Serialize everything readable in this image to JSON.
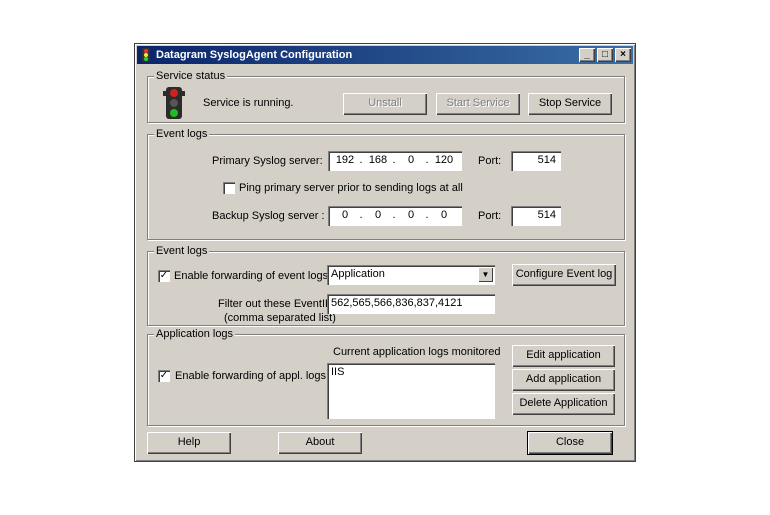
{
  "window": {
    "title": "Datagram SyslogAgent Configuration",
    "controls": {
      "minimize": "_",
      "maximize": "□",
      "close": "×"
    }
  },
  "service_status": {
    "group_label": "Service status",
    "icon": "traffic-light-icon",
    "status_text": "Service is running.",
    "uninstall_label": "Unstall",
    "start_label": "Start Service",
    "stop_label": "Stop Service"
  },
  "event_logs_servers": {
    "group_label": "Event logs",
    "primary_label": "Primary Syslog server:",
    "primary_ip": [
      "192",
      "168",
      "0",
      "120"
    ],
    "primary_port_label": "Port:",
    "primary_port": "514",
    "ping_label": "Ping primary server prior to sending logs at all",
    "ping_checked": "",
    "backup_label": "Backup Syslog server :",
    "backup_ip": [
      "0",
      "0",
      "0",
      "0"
    ],
    "backup_port_label": "Port:",
    "backup_port": "514",
    "ip_separator": "."
  },
  "event_logs_forwarding": {
    "group_label": "Event logs",
    "enable_label": "Enable forwarding of event logs",
    "enable_checked": "✓",
    "log_select_value": "Application",
    "configure_label": "Configure Event log",
    "filter_label": "Filter out these EventIDs:",
    "filter_sublabel": "(comma separated list)",
    "filter_value": "562,565,566,836,837,4121"
  },
  "application_logs": {
    "group_label": "Application logs",
    "enable_label": "Enable forwarding of appl. logs",
    "enable_checked": "✓",
    "monitored_label": "Current application logs monitored",
    "monitored_items": [
      "IIS"
    ],
    "edit_label": "Edit application",
    "add_label": "Add application",
    "delete_label": "Delete Application"
  },
  "footer": {
    "help_label": "Help",
    "about_label": "About",
    "close_label": "Close"
  },
  "colors": {
    "face": "#d4d0c8",
    "title_start": "#0a246a",
    "title_end": "#3a6ea5",
    "light_red": "#cc2222",
    "light_green": "#22bb22"
  }
}
